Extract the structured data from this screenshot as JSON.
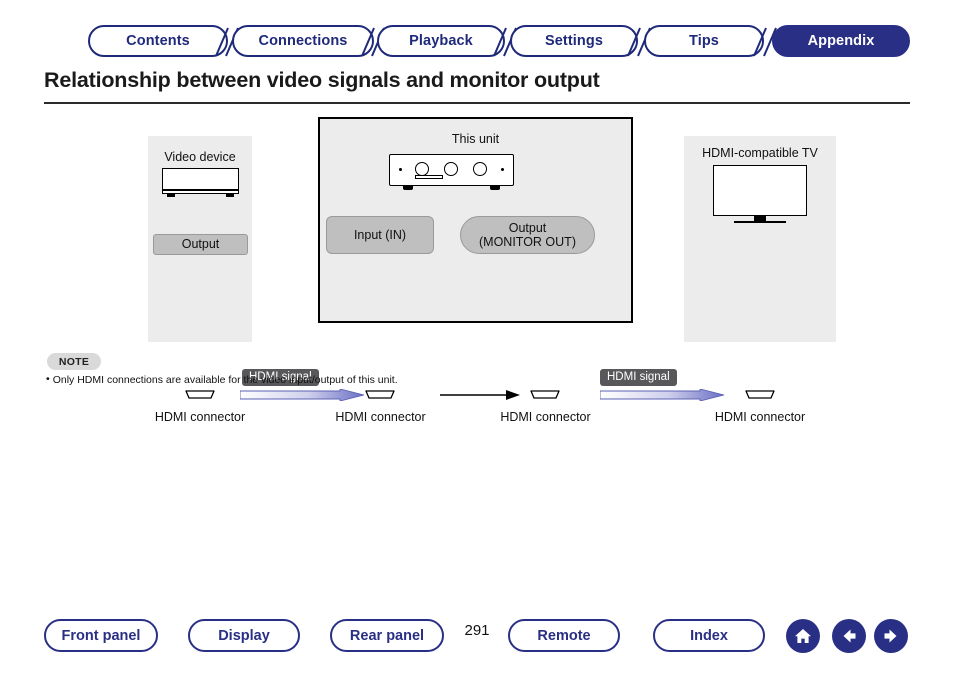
{
  "tabs": [
    {
      "label": "Contents",
      "active": false
    },
    {
      "label": "Connections",
      "active": false
    },
    {
      "label": "Playback",
      "active": false
    },
    {
      "label": "Settings",
      "active": false
    },
    {
      "label": "Tips",
      "active": false
    },
    {
      "label": "Appendix",
      "active": true
    }
  ],
  "title": "Relationship between video signals and monitor output",
  "diagram": {
    "source_device": {
      "title": "Video device",
      "output_label": "Output",
      "connector_label": "HDMI connector"
    },
    "this_unit": {
      "title": "This unit",
      "input_label": "Input (IN)",
      "output_label": "Output\n(MONITOR OUT)",
      "output_label_line1": "Output",
      "output_label_line2": "(MONITOR OUT)",
      "input_connector_label": "HDMI connector",
      "output_connector_label": "HDMI connector"
    },
    "tv": {
      "title": "HDMI-compatible TV",
      "connector_label": "HDMI connector"
    },
    "signal_tag_left": "HDMI signal",
    "signal_tag_right": "HDMI signal"
  },
  "note": {
    "badge": "NOTE",
    "bullet": "•",
    "text": "Only HDMI connections are available for the video input/output of this unit."
  },
  "footer": {
    "buttons": [
      {
        "label": "Front panel"
      },
      {
        "label": "Display"
      },
      {
        "label": "Rear panel"
      },
      {
        "label": "Remote"
      },
      {
        "label": "Index"
      }
    ],
    "page_number": "291",
    "icons": [
      {
        "name": "home-icon"
      },
      {
        "name": "arrow-left-icon"
      },
      {
        "name": "arrow-right-icon"
      }
    ]
  },
  "colors": {
    "accent": "#2a2f86",
    "tab_border": "#1f2a7a",
    "panel_bg": "#ececec",
    "capsule_bg": "#bfbfbf",
    "signal_tag_bg": "#58585a",
    "arrow_fill": "#6a6fc4"
  }
}
